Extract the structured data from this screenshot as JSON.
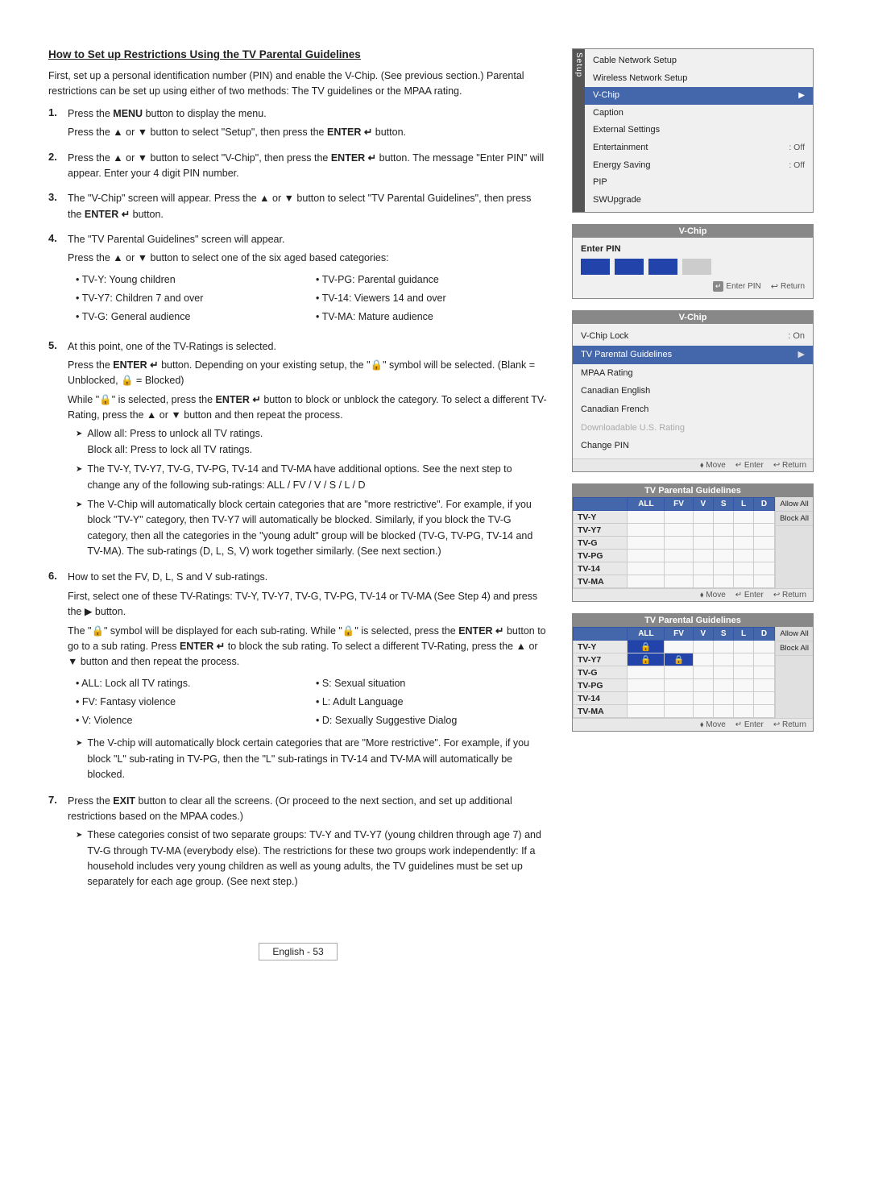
{
  "page": {
    "title": "How to Set up Restrictions Using the TV Parental Guidelines",
    "intro": "First, set up a personal identification number (PIN) and enable the V-Chip. (See previous section.) Parental restrictions can be set up using either of two methods: The TV guidelines or the MPAA rating.",
    "steps": [
      {
        "num": "1.",
        "lines": [
          "Press the MENU button to display the menu.",
          "Press the ▲ or ▼ button to select \"Setup\", then press the ENTER ↵ button."
        ]
      },
      {
        "num": "2.",
        "lines": [
          "Press the ▲ or ▼ button to select \"V-Chip\", then press the ENTER ↵ button. The message \"Enter PIN\" will appear. Enter your 4 digit PIN number."
        ]
      },
      {
        "num": "3.",
        "lines": [
          "The \"V-Chip\" screen will appear. Press the ▲ or ▼ button to select \"TV Parental Guidelines\", then press the ENTER ↵ button."
        ]
      },
      {
        "num": "4.",
        "lines": [
          "The \"TV Parental Guidelines\" screen will appear.",
          "Press the ▲ or ▼ button to select one of the six aged based categories:"
        ]
      }
    ],
    "categories_col1": [
      "TV-Y: Young children",
      "TV-Y7: Children 7 and over",
      "TV-G: General audience"
    ],
    "categories_col2": [
      "TV-PG: Parental guidance",
      "TV-14: Viewers 14 and over",
      "TV-MA: Mature audience"
    ],
    "step5_intro": "At this point, one of the TV-Ratings is selected.",
    "step5_p1": "Press the ENTER ↵ button. Depending on your existing setup, the \"🔒\" symbol will be selected. (Blank = Unblocked, 🔒 = Blocked)",
    "step5_p2": "While \"🔒\" is selected, press the ENTER ↵ button to block or unblock the category. To select a different TV-Rating, press the ▲ or ▼ button and then repeat the process.",
    "step5_bullets": [
      "Allow all: Press to unlock all TV ratings.",
      "Block all: Press to lock all TV ratings."
    ],
    "step5_arrows": [
      "The TV-Y, TV-Y7, TV-G, TV-PG, TV-14 and TV-MA have additional options. See the next step to change any of the following sub-ratings: ALL / FV / V / S / L / D",
      "The V-Chip will automatically block certain categories that are \"more restrictive\". For example, if you block \"TV-Y\" category, then TV-Y7 will automatically be blocked. Similarly, if you block the TV-G category, then all the categories in the \"young adult\" group will be blocked (TV-G, TV-PG, TV-14 and TV-MA). The sub-ratings (D, L, S, V) work together similarly. (See next section.)"
    ],
    "step6_intro": "How to set the FV, D, L, S and V sub-ratings.",
    "step6_p1": "First, select one of these TV-Ratings: TV-Y, TV-Y7, TV-G, TV-PG, TV-14 or TV-MA (See Step 4) and press the ▶ button.",
    "step6_p2": "The \"🔒\" symbol will be displayed for each sub-rating. While \"🔒\" is selected, press the ENTER ↵ button to go to a sub rating. Press ENTER ↵ to block the sub rating. To select a different TV-Rating, press the ▲ or ▼ button and then repeat the process.",
    "subratings_col1": [
      "ALL: Lock all TV ratings.",
      "FV: Fantasy violence",
      "V: Violence"
    ],
    "subratings_col2": [
      "S: Sexual situation",
      "L: Adult Language",
      "D: Sexually Suggestive Dialog"
    ],
    "step6_arrow": "The V-chip will automatically block certain categories that are \"More restrictive\". For example, if you block \"L\" sub-rating in TV-PG, then the \"L\" sub-ratings in TV-14 and TV-MA will automatically be blocked.",
    "step7_intro": "Press the EXIT button to clear all the screens. (Or proceed to the next section, and set up additional restrictions based on the MPAA codes.)",
    "step7_arrow": "These categories consist of two separate groups: TV-Y and TV-Y7 (young children through age 7) and TV-G through TV-MA (everybody else). The restrictions for these two groups work independently: If a household includes very young children as well as young adults, the TV guidelines must be set up separately for each age group. (See next step.)",
    "footer": "English - 53"
  },
  "sidebar": {
    "panel1": {
      "title": "Setup",
      "items": [
        {
          "label": "Cable Network Setup",
          "value": "",
          "highlighted": false
        },
        {
          "label": "Wireless Network Setup",
          "value": "",
          "highlighted": false
        },
        {
          "label": "V-Chip",
          "value": "",
          "highlighted": true,
          "arrow": "▶"
        },
        {
          "label": "Caption",
          "value": "",
          "highlighted": false
        },
        {
          "label": "External Settings",
          "value": "",
          "highlighted": false
        },
        {
          "label": "Entertainment",
          "value": ": Off",
          "highlighted": false
        },
        {
          "label": "Energy Saving",
          "value": ": Off",
          "highlighted": false
        },
        {
          "label": "PIP",
          "value": "",
          "highlighted": false
        },
        {
          "label": "SWUpgrade",
          "value": "",
          "highlighted": false
        }
      ]
    },
    "panel2": {
      "title": "V-Chip",
      "enter_pin_label": "Enter PIN",
      "pin_dots": [
        "•",
        "•",
        "•",
        ""
      ],
      "footer": [
        "Enter PIN",
        "Return"
      ]
    },
    "panel3": {
      "title": "V-Chip",
      "items": [
        {
          "label": "V-Chip Lock",
          "value": ": On",
          "highlighted": false
        },
        {
          "label": "TV Parental Guidelines",
          "value": "",
          "highlighted": true,
          "arrow": "▶"
        },
        {
          "label": "MPAA Rating",
          "value": "",
          "highlighted": false
        },
        {
          "label": "Canadian English",
          "value": "",
          "highlighted": false
        },
        {
          "label": "Canadian French",
          "value": "",
          "highlighted": false
        },
        {
          "label": "Downloadable U.S. Rating",
          "value": "",
          "highlighted": false,
          "dimmed": true
        },
        {
          "label": "Change PIN",
          "value": "",
          "highlighted": false
        }
      ],
      "footer": [
        "Move",
        "Enter",
        "Return"
      ]
    },
    "panel4": {
      "title": "TV Parental Guidelines",
      "headers": [
        "ALL",
        "FV",
        "V",
        "S",
        "L",
        "D"
      ],
      "rows": [
        {
          "label": "TV-Y",
          "cells": [
            false,
            false,
            false,
            false,
            false,
            false
          ]
        },
        {
          "label": "TV-Y7",
          "cells": [
            false,
            false,
            false,
            false,
            false,
            false
          ]
        },
        {
          "label": "TV-G",
          "cells": [
            false,
            false,
            false,
            false,
            false,
            false
          ]
        },
        {
          "label": "TV-PG",
          "cells": [
            false,
            false,
            false,
            false,
            false,
            false
          ]
        },
        {
          "label": "TV-14",
          "cells": [
            false,
            false,
            false,
            false,
            false,
            false
          ]
        },
        {
          "label": "TV-MA",
          "cells": [
            false,
            false,
            false,
            false,
            false,
            false
          ]
        }
      ],
      "btns": [
        "Allow All",
        "Block All"
      ],
      "footer": [
        "Move",
        "Enter",
        "Return"
      ]
    },
    "panel5": {
      "title": "TV Parental Guidelines",
      "headers": [
        "ALL",
        "FV",
        "V",
        "S",
        "L",
        "D"
      ],
      "rows": [
        {
          "label": "TV-Y",
          "cells": [
            true,
            false,
            false,
            false,
            false,
            false
          ]
        },
        {
          "label": "TV-Y7",
          "cells": [
            true,
            true,
            false,
            false,
            false,
            false
          ]
        },
        {
          "label": "TV-G",
          "cells": [
            false,
            false,
            false,
            false,
            false,
            false
          ]
        },
        {
          "label": "TV-PG",
          "cells": [
            false,
            false,
            false,
            false,
            false,
            false
          ]
        },
        {
          "label": "TV-14",
          "cells": [
            false,
            false,
            false,
            false,
            false,
            false
          ]
        },
        {
          "label": "TV-MA",
          "cells": [
            false,
            false,
            false,
            false,
            false,
            false
          ]
        }
      ],
      "btns": [
        "Allow All",
        "Block All"
      ],
      "footer": [
        "Move",
        "Enter",
        "Return"
      ]
    }
  }
}
